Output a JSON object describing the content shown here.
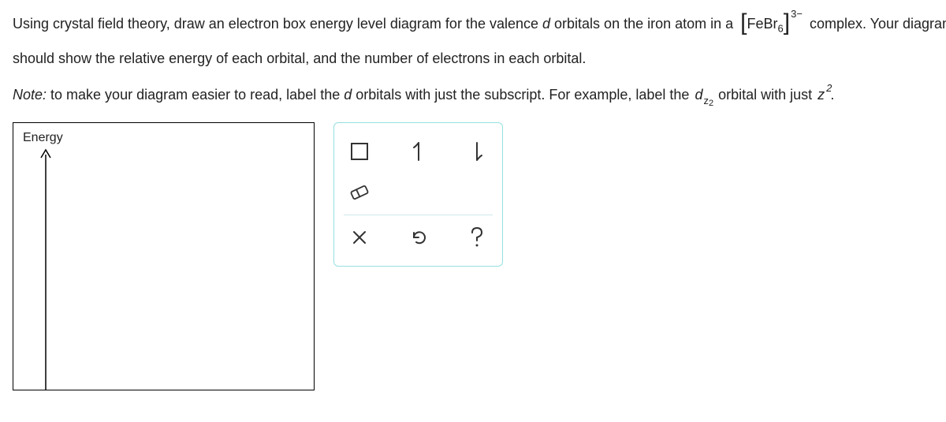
{
  "prompt": {
    "line1_prefix": "Using crystal field theory, draw an electron box energy level diagram for the valence ",
    "d_letter": "d",
    "line1_mid": " orbitals on the iron atom in a ",
    "complex_formula": "FeBr",
    "complex_sub": "6",
    "complex_charge": "3−",
    "line1_suffix": " complex. Your diagram",
    "line2": "should show the relative energy of each orbital, and the number of electrons in each orbital."
  },
  "note": {
    "prefix_italic": "Note:",
    "body1": " to make your diagram easier to read, label the ",
    "body2": " orbitals with just the subscript. For example, label the ",
    "dz_base": "d",
    "dz_sub_base": "z",
    "dz_sub_sup": "2",
    "body3": " orbital with just ",
    "z_base": "z",
    "z_sup": "2",
    "body_end": "."
  },
  "canvas": {
    "energy_label": "Energy"
  },
  "tools": {
    "box": "box-icon",
    "arrow_up": "arrow-up-icon",
    "arrow_down": "arrow-down-icon",
    "eraser": "eraser-icon",
    "clear": "clear-icon",
    "undo": "undo-icon",
    "help": "help-icon"
  }
}
